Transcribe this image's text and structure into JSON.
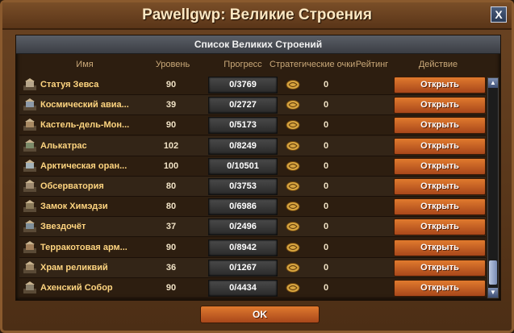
{
  "window": {
    "title": "Pawellgwp: Великие Строения",
    "close_label": "X"
  },
  "list": {
    "header": "Список Великих Строений",
    "columns": {
      "name": "Имя",
      "level": "Уровень",
      "progress": "Прогресс",
      "strategy_points": "Стратегические очки",
      "rating": "Рейтинг",
      "action": "Действие"
    },
    "rows": [
      {
        "name": "Статуя Зевса",
        "level": "90",
        "progress": "0/3769",
        "sp": "0",
        "action": "Открыть",
        "icon": "statue-icon"
      },
      {
        "name": "Космический авиа...",
        "level": "39",
        "progress": "0/2727",
        "sp": "0",
        "action": "Открыть",
        "icon": "spaceport-icon"
      },
      {
        "name": "Кастель-дель-Мон...",
        "level": "90",
        "progress": "0/5173",
        "sp": "0",
        "action": "Открыть",
        "icon": "castle-icon"
      },
      {
        "name": "Алькатрас",
        "level": "102",
        "progress": "0/8249",
        "sp": "0",
        "action": "Открыть",
        "icon": "prison-icon"
      },
      {
        "name": "Арктическая оран...",
        "level": "100",
        "progress": "0/10501",
        "sp": "0",
        "action": "Открыть",
        "icon": "greenhouse-icon"
      },
      {
        "name": "Обсерватория",
        "level": "80",
        "progress": "0/3753",
        "sp": "0",
        "action": "Открыть",
        "icon": "observatory-icon"
      },
      {
        "name": "Замок Химэдзи",
        "level": "80",
        "progress": "0/6986",
        "sp": "0",
        "action": "Открыть",
        "icon": "castle-icon"
      },
      {
        "name": "Звездочёт",
        "level": "37",
        "progress": "0/2496",
        "sp": "0",
        "action": "Открыть",
        "icon": "star-gazer-icon"
      },
      {
        "name": "Терракотовая арм...",
        "level": "90",
        "progress": "0/8942",
        "sp": "0",
        "action": "Открыть",
        "icon": "terracotta-icon"
      },
      {
        "name": "Храм реликвий",
        "level": "36",
        "progress": "0/1267",
        "sp": "0",
        "action": "Открыть",
        "icon": "temple-icon"
      },
      {
        "name": "Ахенский Собор",
        "level": "90",
        "progress": "0/4434",
        "sp": "0",
        "action": "Открыть",
        "icon": "cathedral-icon"
      }
    ]
  },
  "footer": {
    "ok_label": "OK"
  },
  "colors": {
    "accent_button": "#d06a28",
    "name_text": "#ffd580",
    "window_bg": "#5a3518"
  }
}
